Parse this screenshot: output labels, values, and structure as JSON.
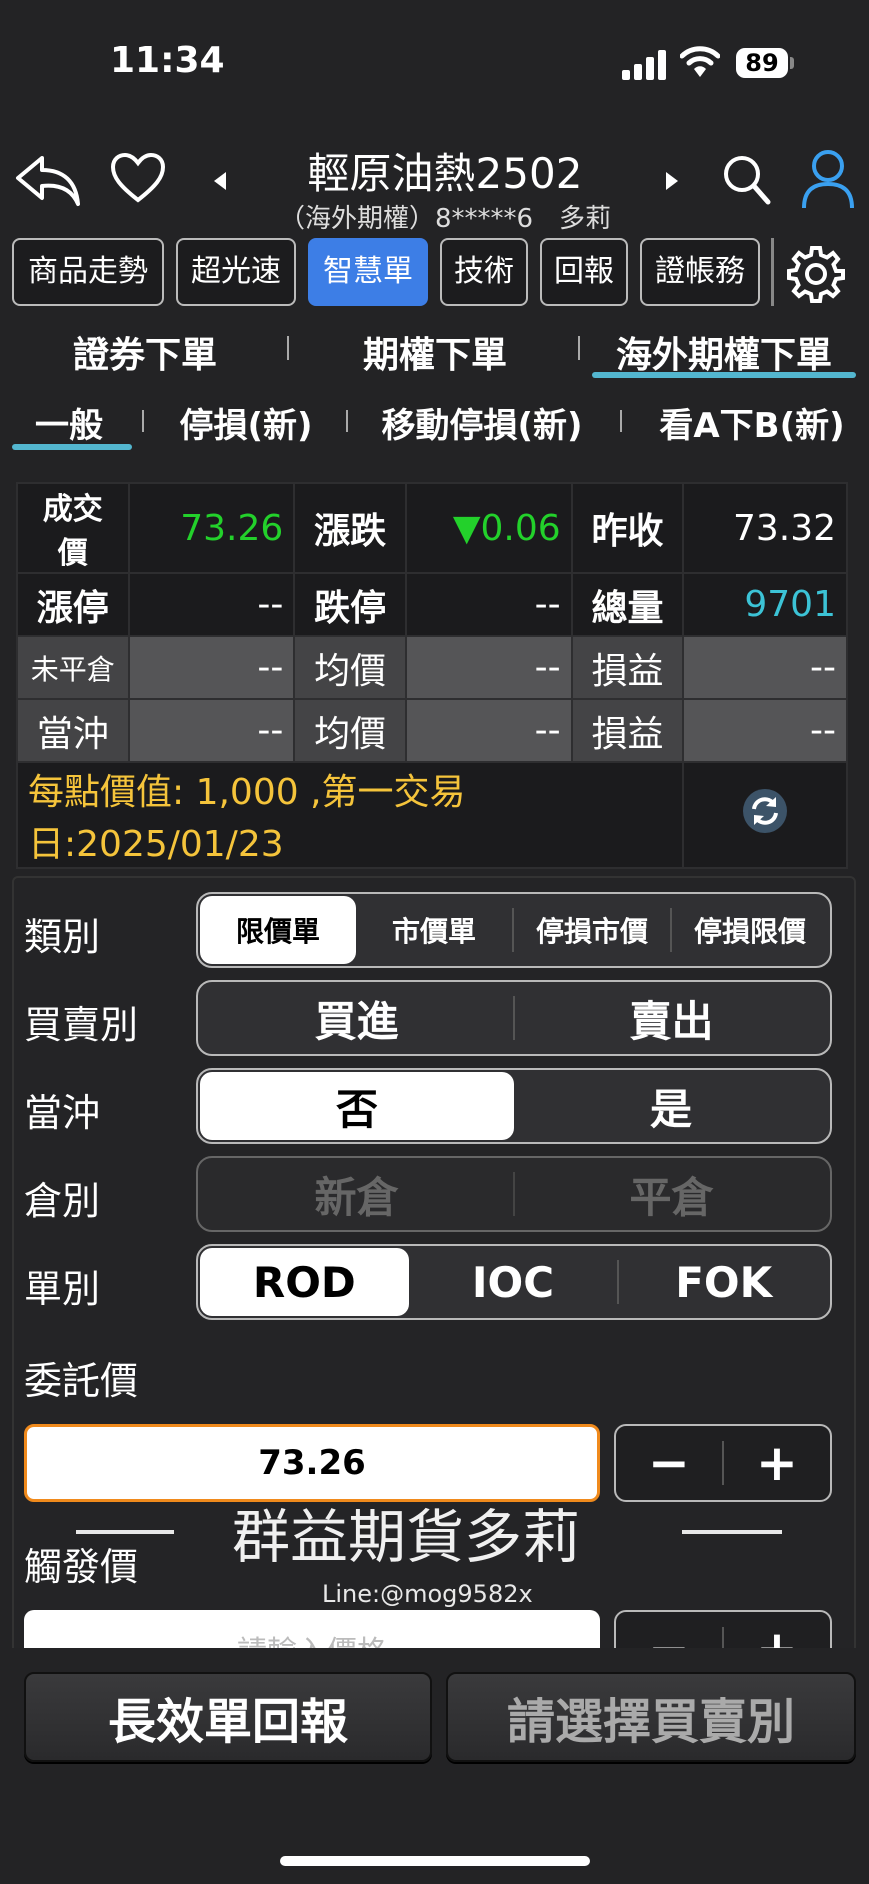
{
  "status_bar": {
    "time": "11:34",
    "battery": "89"
  },
  "header": {
    "title": "輕原油熱2502",
    "subtitle": "（海外期權）8*****6　多莉"
  },
  "toolbar": {
    "buttons": [
      "商品走勢",
      "超光速",
      "智慧單",
      "技術",
      "回報",
      "證帳務"
    ],
    "active": "智慧單"
  },
  "order_tabs": [
    "證券下單",
    "期權下單",
    "海外期權下單"
  ],
  "active_order_tab": "海外期權下單",
  "sub_tabs": [
    "一般",
    "停損(新)",
    "移動停損(新)",
    "看A下B(新)"
  ],
  "active_sub_tab": "一般",
  "quote": {
    "row1": {
      "l1": "成交價",
      "v1": "73.26",
      "l2": "漲跌",
      "v2": "▼0.06",
      "l3": "昨收",
      "v3": "73.32"
    },
    "row2": {
      "l1": "漲停",
      "v1": "--",
      "l2": "跌停",
      "v2": "--",
      "l3": "總量",
      "v3": "9701"
    },
    "row3": {
      "l1": "未平倉",
      "v1": "--",
      "l2": "均價",
      "v2": "--",
      "l3": "損益",
      "v3": "--"
    },
    "row4": {
      "l1": "當沖",
      "v1": "--",
      "l2": "均價",
      "v2": "--",
      "l3": "損益",
      "v3": "--"
    },
    "info": "每點價值: 1,000 ,第一交易日:2025/01/23"
  },
  "colors": {
    "up_down": "#23d12b",
    "volume": "#3cc3d6",
    "info": "#f5c43b",
    "accent": "#3d7ee6",
    "underline": "#53b6cf",
    "input_border": "#f08a1c"
  },
  "form": {
    "type_label": "類別",
    "type_options": [
      "限價單",
      "市價單",
      "停損市價",
      "停損限價"
    ],
    "type_selected": "限價單",
    "side_label": "買賣別",
    "side_options": [
      "買進",
      "賣出"
    ],
    "daytrade_label": "當沖",
    "daytrade_options": [
      "否",
      "是"
    ],
    "daytrade_selected": "否",
    "position_label": "倉別",
    "position_options": [
      "新倉",
      "平倉"
    ],
    "tif_label": "單別",
    "tif_options": [
      "ROD",
      "IOC",
      "FOK"
    ],
    "tif_selected": "ROD",
    "price_label": "委託價",
    "price_value": "73.26",
    "trigger_label": "觸發價",
    "trigger_placeholder": "請輸入價格",
    "minus": "−",
    "plus": "+"
  },
  "watermark": {
    "text": "群益期貨多莉",
    "sub": "Line:@mog9582x"
  },
  "bottom": {
    "left_button": "長效單回報",
    "right_button": "請選擇買賣別"
  }
}
